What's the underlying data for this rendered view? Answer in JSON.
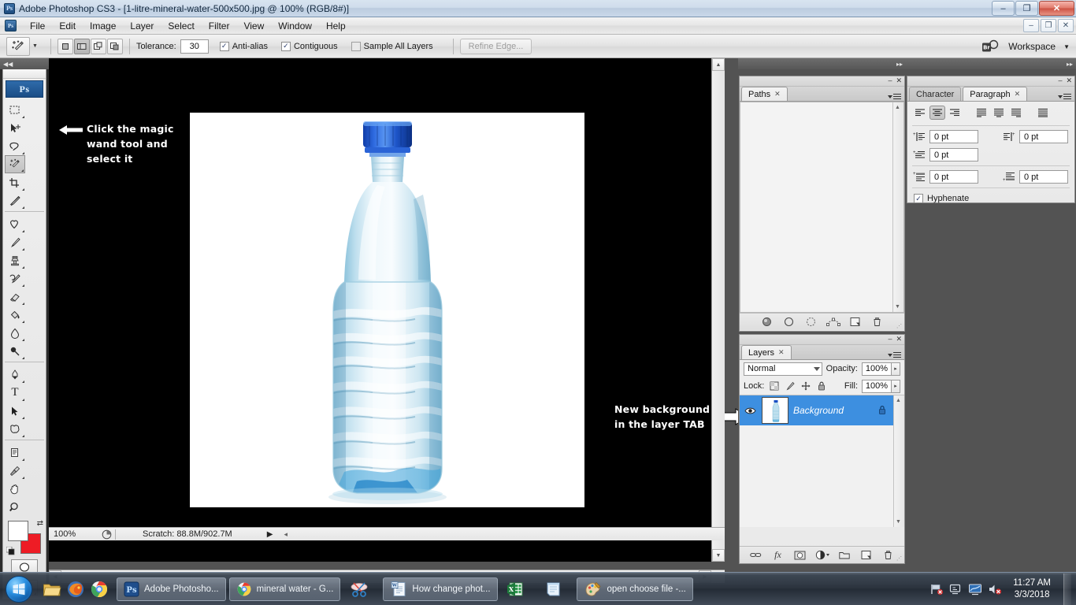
{
  "window": {
    "title": "Adobe Photoshop CS3 - [1-litre-mineral-water-500x500.jpg @ 100% (RGB/8#)]",
    "app_icon": "photoshop-icon",
    "minimize": "–",
    "maximize": "❐",
    "close": "✕"
  },
  "document_window": {
    "minimize": "–",
    "restore": "❐",
    "close": "✕"
  },
  "menubar": {
    "items": [
      {
        "label": "File"
      },
      {
        "label": "Edit"
      },
      {
        "label": "Image"
      },
      {
        "label": "Layer"
      },
      {
        "label": "Select"
      },
      {
        "label": "Filter"
      },
      {
        "label": "View"
      },
      {
        "label": "Window"
      },
      {
        "label": "Help"
      }
    ]
  },
  "options_bar": {
    "active_tool": "magic-wand-tool",
    "tolerance_label": "Tolerance:",
    "tolerance_value": "30",
    "anti_alias_label": "Anti-alias",
    "anti_alias_checked": true,
    "contiguous_label": "Contiguous",
    "contiguous_checked": true,
    "sample_all_layers_label": "Sample All Layers",
    "sample_all_layers_checked": false,
    "refine_edge_label": "Refine Edge...",
    "refine_edge_enabled": false,
    "bridge_label": "Br",
    "workspace_label": "Workspace",
    "selection_modes": [
      "new-selection",
      "add-to-selection",
      "subtract-from-selection",
      "intersect-with-selection"
    ],
    "selection_mode_active": 1
  },
  "toolbox": {
    "badge": "Ps",
    "selected_tool": "magic-wand-tool",
    "tools": [
      "rectangular-marquee-tool",
      "move-tool",
      "lasso-tool",
      "magic-wand-tool",
      "crop-tool",
      "slice-tool",
      "healing-brush-tool",
      "brush-tool",
      "clone-stamp-tool",
      "history-brush-tool",
      "eraser-tool",
      "paint-bucket-tool",
      "blur-tool",
      "dodge-tool",
      "pen-tool",
      "horizontal-type-tool",
      "path-selection-tool",
      "custom-shape-tool",
      "notes-tool",
      "eyedropper-tool",
      "hand-tool",
      "zoom-tool"
    ],
    "foreground_color": "#ffffff",
    "background_color": "#ee1c25",
    "quick_mask_label": "quick-mask-mode",
    "screen_mode_label": "screen-mode"
  },
  "canvas": {
    "background": "#000000",
    "image_name": "1-litre-mineral-water-500x500.jpg",
    "image_subject": "plastic mineral water bottle with blue cap",
    "image_background": "#ffffff",
    "cap_color": "#1a4fc4",
    "bottle_tint": "#bfe0ee"
  },
  "status_bar": {
    "zoom": "100%",
    "scratch": "Scratch: 88.8M/902.7M",
    "play_glyph": "▶",
    "left_glyph": "◂"
  },
  "annotations": [
    {
      "id": "annotation-magic-wand",
      "text_lines": [
        "Click the magic",
        "wand tool and",
        "select it"
      ],
      "arrow": "left-arrow",
      "color": "#ffffff"
    },
    {
      "id": "annotation-new-background",
      "text_lines": [
        "New background",
        "in the layer TAB"
      ],
      "arrow": "right-arrow",
      "color": "#ffffff"
    }
  ],
  "paths_panel": {
    "tab_label": "Paths",
    "tab_close": "✕",
    "minimize": "–",
    "close": "✕",
    "items": [],
    "footer_buttons": [
      "fill-path-with-foreground-color",
      "stroke-path-with-brush",
      "load-path-as-selection",
      "make-work-path-from-selection",
      "create-new-path",
      "delete-current-path"
    ]
  },
  "layers_panel": {
    "tab_label": "Layers",
    "tab_close": "✕",
    "minimize": "–",
    "close": "✕",
    "blend_mode": "Normal",
    "opacity_label": "Opacity:",
    "opacity_value": "100%",
    "lock_label": "Lock:",
    "fill_label": "Fill:",
    "fill_value": "100%",
    "lock_buttons": [
      "lock-transparent-pixels",
      "lock-image-pixels",
      "lock-position",
      "lock-all"
    ],
    "layers": [
      {
        "name": "Background",
        "visible": true,
        "locked": true,
        "selected": true,
        "thumbnail": "water-bottle-thumbnail"
      }
    ],
    "footer_buttons": [
      "link-layers",
      "add-layer-style",
      "add-layer-mask",
      "create-new-fill-or-adjustment-layer",
      "create-new-group",
      "create-new-layer",
      "delete-layer"
    ]
  },
  "paragraph_panel": {
    "tabs": [
      {
        "label": "Character",
        "active": false
      },
      {
        "label": "Paragraph",
        "active": true
      }
    ],
    "tab_close": "✕",
    "minimize": "–",
    "close": "✕",
    "align_buttons": [
      "align-text-left",
      "align-text-center",
      "align-text-right",
      "justify-last-left",
      "justify-last-centered",
      "justify-last-right",
      "justify-all"
    ],
    "align_active": 1,
    "fields": [
      {
        "icon": "indent-left-margin",
        "value": "0 pt"
      },
      {
        "icon": "indent-right-margin",
        "value": "0 pt"
      },
      {
        "icon": "indent-first-line",
        "value": "0 pt"
      },
      {
        "icon": "space-before-paragraph",
        "value": "0 pt"
      },
      {
        "icon": "space-after-paragraph",
        "value": "0 pt"
      }
    ],
    "hyphenate_label": "Hyphenate",
    "hyphenate_checked": true
  },
  "taskbar": {
    "start_label": "start-orb",
    "quick_launch": [
      "windows-explorer-icon",
      "firefox-icon",
      "google-chrome-icon"
    ],
    "items": [
      {
        "label": "Adobe Photosho...",
        "icon": "photoshop-icon",
        "active": true
      },
      {
        "label": "mineral water - G...",
        "icon": "google-chrome-icon",
        "active": false
      },
      {
        "label": "",
        "icon": "snipping-tool-icon",
        "active": false
      },
      {
        "label": "How change phot...",
        "icon": "word-document-icon",
        "active": false
      },
      {
        "label": "",
        "icon": "excel-icon",
        "active": false
      },
      {
        "label": "",
        "icon": "notepad-icon",
        "active": false
      },
      {
        "label": "open choose file -...",
        "icon": "paint-icon",
        "active": false
      }
    ],
    "tray_icons": [
      "network-flag-icon",
      "action-center-icon",
      "display-icon",
      "volume-muted-icon"
    ],
    "clock_time": "11:27 AM",
    "clock_date": "3/3/2018"
  }
}
